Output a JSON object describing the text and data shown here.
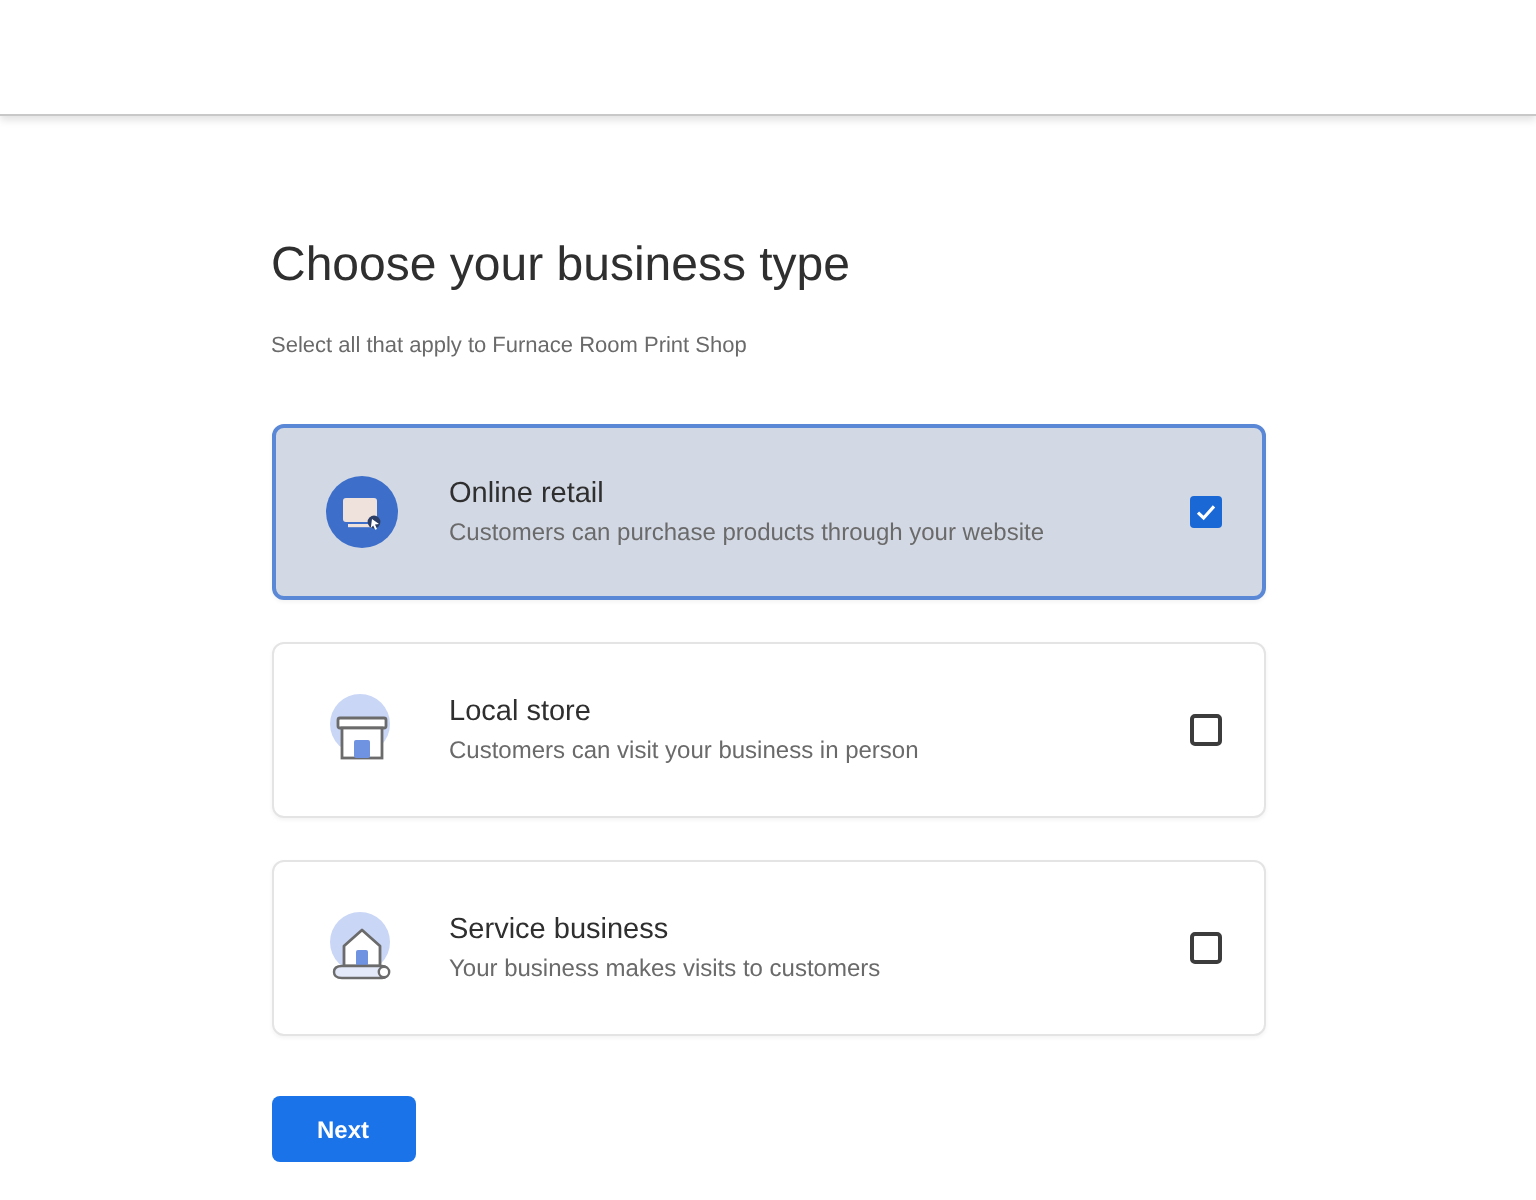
{
  "title": "Choose your business type",
  "subtitle": "Select all that apply to Furnace Room Print Shop",
  "options": [
    {
      "kind": "online",
      "title": "Online retail",
      "description": "Customers can purchase products through your website",
      "checked": true
    },
    {
      "kind": "store",
      "title": "Local store",
      "description": "Customers can visit your business in person",
      "checked": false
    },
    {
      "kind": "service",
      "title": "Service business",
      "description": "Your business makes visits to customers",
      "checked": false
    }
  ],
  "next_button": "Next"
}
